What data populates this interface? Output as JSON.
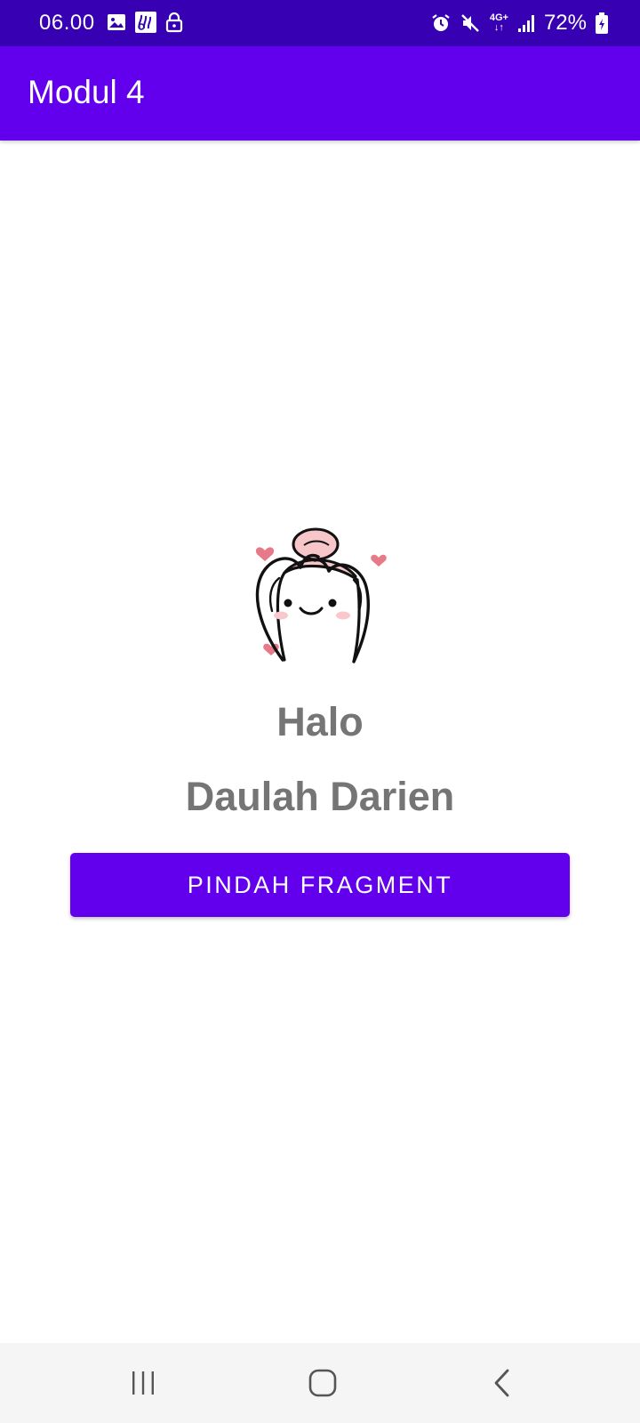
{
  "status_bar": {
    "time": "06.00",
    "battery": "72%",
    "network": "4G+",
    "left_icons": [
      "gallery-icon",
      "app-notification-icon",
      "lock-icon"
    ],
    "right_icons": [
      "alarm-icon",
      "mute-icon",
      "network-4g-icon",
      "signal-icon",
      "battery-charging-icon"
    ]
  },
  "app_bar": {
    "title": "Modul 4"
  },
  "content": {
    "sticker": "heart-hands-character",
    "greeting": "Halo",
    "name": "Daulah Darien",
    "button_label": "PINDAH FRAGMENT"
  },
  "nav_bar": {
    "buttons": [
      "recent-apps",
      "home",
      "back"
    ]
  },
  "colors": {
    "status_bar": "#3700b3",
    "app_bar": "#6200ee",
    "button": "#6200ee",
    "text_gray": "#757575",
    "nav_bar": "#f5f5f5",
    "heart_pink": "#e67a88"
  }
}
